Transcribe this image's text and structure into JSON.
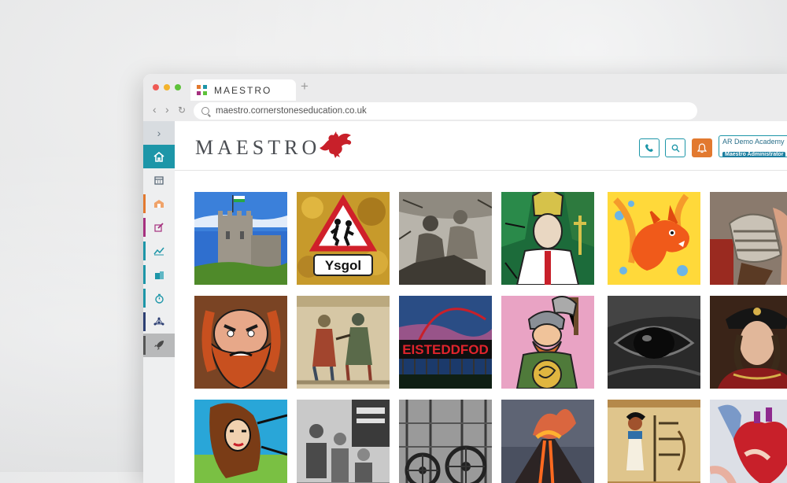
{
  "browser": {
    "tab_title": "MAESTRO",
    "new_tab": "+",
    "url": "maestro.cornerstoneseducation.co.uk",
    "dots": [
      "#ef5a55",
      "#f3b32d",
      "#5ec23b"
    ]
  },
  "sidebar": {
    "items": [
      {
        "name": "expand",
        "icon": "chevron-right-icon",
        "accent": ""
      },
      {
        "name": "home",
        "icon": "home-icon",
        "accent": "#1d96a8"
      },
      {
        "name": "calendar",
        "icon": "calendar-icon",
        "accent": ""
      },
      {
        "name": "school",
        "icon": "school-icon",
        "accent": "#e2792f"
      },
      {
        "name": "edit",
        "icon": "pencil-icon",
        "accent": "#a6317f"
      },
      {
        "name": "analytics",
        "icon": "chart-icon",
        "accent": "#1d96a8"
      },
      {
        "name": "buildings",
        "icon": "buildings-icon",
        "accent": "#1d96a8"
      },
      {
        "name": "timer",
        "icon": "stopwatch-icon",
        "accent": "#1d96a8"
      },
      {
        "name": "network",
        "icon": "network-icon",
        "accent": "#2c3f73"
      },
      {
        "name": "launch",
        "icon": "rocket-icon",
        "accent": "#555555"
      }
    ]
  },
  "header": {
    "logo": "MAESTRO",
    "logo_emblem": "welsh-dragon-icon",
    "buttons": [
      "phone-icon",
      "search-icon",
      "bell-icon"
    ],
    "account_name": "AR Demo Academy",
    "account_role": "Maestro Administrator"
  },
  "tiles": [
    {
      "name": "cardiff-castle",
      "label": ""
    },
    {
      "name": "ysgol-sign",
      "label": "Ysgol"
    },
    {
      "name": "engraving-scene",
      "label": ""
    },
    {
      "name": "stained-glass-saint",
      "label": ""
    },
    {
      "name": "fire-dragon",
      "label": ""
    },
    {
      "name": "roman-soldier",
      "label": ""
    },
    {
      "name": "red-bearded-giant",
      "label": ""
    },
    {
      "name": "tapestry",
      "label": ""
    },
    {
      "name": "eisteddfod",
      "label": "EISTEDDFOD"
    },
    {
      "name": "viking",
      "label": ""
    },
    {
      "name": "horse-eye",
      "label": ""
    },
    {
      "name": "tudor-king",
      "label": ""
    },
    {
      "name": "woman-portrait",
      "label": ""
    },
    {
      "name": "evacuee-children",
      "label": ""
    },
    {
      "name": "industrial-machinery",
      "label": ""
    },
    {
      "name": "volcano",
      "label": ""
    },
    {
      "name": "egyptian-art",
      "label": ""
    },
    {
      "name": "anatomy-heart",
      "label": ""
    }
  ],
  "colors": {
    "teal": "#1d96a8",
    "orange": "#e2792f",
    "dragon_red": "#c8202a"
  }
}
